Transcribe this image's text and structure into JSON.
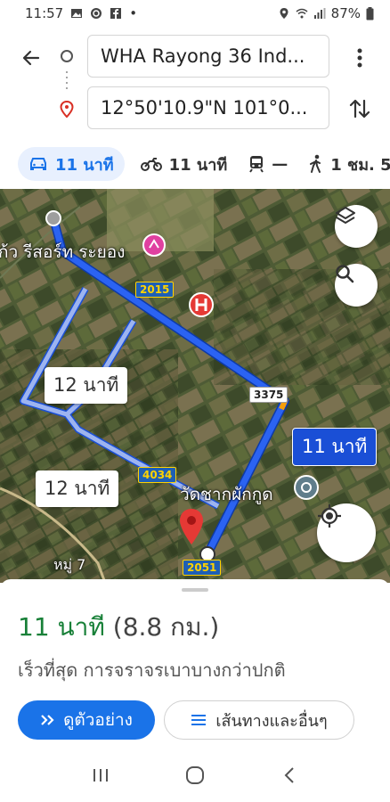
{
  "status_bar": {
    "time": "11:57",
    "battery": "87%",
    "dot": "•"
  },
  "search": {
    "origin": "WHA Rayong 36 Ind...",
    "destination": "12°50'10.9\"N 101°0..."
  },
  "modes": [
    {
      "icon": "car-icon",
      "label": "11 นาที",
      "active": true
    },
    {
      "icon": "motorcycle-icon",
      "label": "11 นาที",
      "active": false
    },
    {
      "icon": "transit-icon",
      "label": "—",
      "active": false
    },
    {
      "icon": "walk-icon",
      "label": "1 ชม. 5",
      "active": false
    }
  ],
  "map": {
    "labels": {
      "resort": "ก้ว รีสอร์ท ระยอง",
      "temple": "วัดชากผักกูด",
      "village": "หมู่ 7"
    },
    "shields": {
      "r2015": "2015",
      "r3375": "3375",
      "r4034": "4034",
      "r2051": "2051"
    },
    "bubbles": {
      "primary": "11 นาที",
      "alt1": "12 นาที",
      "alt2": "12 นาที"
    },
    "colors": {
      "route": "#1a4fd6",
      "alt_route": "#9db4f0",
      "pin": "#e53935"
    }
  },
  "sheet": {
    "time": "11 นาที",
    "distance": "(8.8 กม.)",
    "description": "เร็วที่สุด การจราจรเบาบางกว่าปกติ",
    "preview_label": "ดูตัวอย่าง",
    "steps_label": "เส้นทางและอื่นๆ",
    "accent": "#1a73e8",
    "time_color": "#188038"
  }
}
